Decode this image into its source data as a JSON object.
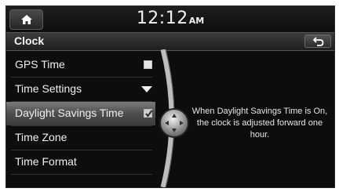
{
  "status": {
    "time": "12:12",
    "ampm": "AM"
  },
  "header": {
    "title": "Clock"
  },
  "menu": {
    "items": [
      {
        "label": "GPS Time",
        "control": "checkbox",
        "checked": false
      },
      {
        "label": "Time Settings",
        "control": "dropdown"
      },
      {
        "label": "Daylight Savings Time",
        "control": "checkbox",
        "checked": true,
        "selected": true
      },
      {
        "label": "Time Zone"
      },
      {
        "label": "Time Format"
      }
    ]
  },
  "description": "When Daylight Savings Time is On, the clock is adjusted forward one hour.",
  "icons": {
    "home": "home-icon",
    "back": "back-arrow-icon",
    "scroll": "scroll-knob-icon"
  },
  "colors": {
    "background": "#0d0d0d",
    "selected_row": "#5a5a5a",
    "text": "#f0f0f0"
  }
}
